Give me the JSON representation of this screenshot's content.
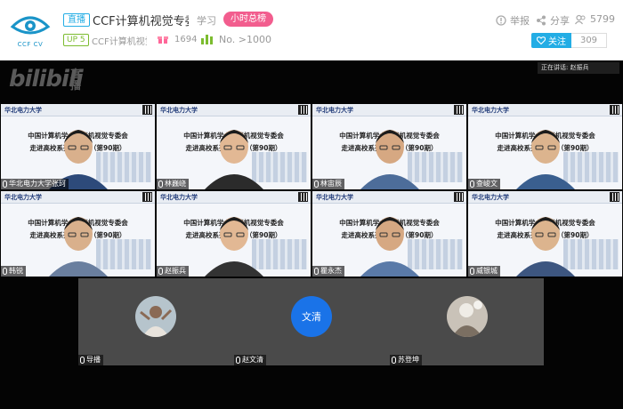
{
  "header": {
    "logo_text": "CCF CV",
    "live_badge": "直播",
    "room_title": "CCF计算机视觉专委会",
    "area": "学习",
    "rank_button": "小时总榜",
    "up_badge": "UP 5",
    "up_name": "CCF计算机视觉",
    "gift_count": "1694",
    "rank_text": "No. >1000",
    "report": "举报",
    "share": "分享",
    "viewers": "5799",
    "follow": "关注",
    "followers": "309",
    "accent": "#23ade5"
  },
  "player": {
    "brand": "bilibili",
    "brand_live": "直播",
    "speaker_label": "正在讲话: 赵振兵",
    "slide": {
      "university": "华北电力大学",
      "line1": "中国计算机学会计算机视觉专委会",
      "line2": "走进高校系列报告会（第90期）"
    },
    "tiles": [
      {
        "name": "华北电力大学张珂"
      },
      {
        "name": "林巍峣"
      },
      {
        "name": "林宙辰"
      },
      {
        "name": "查峻文"
      },
      {
        "name": "韩锐"
      },
      {
        "name": "赵振兵"
      },
      {
        "name": "瞿永杰"
      },
      {
        "name": "威银城"
      }
    ],
    "bottom": [
      {
        "name": "导播"
      },
      {
        "name": "赵文清",
        "avatar_text": "文清"
      },
      {
        "name": "苏登坤"
      }
    ]
  }
}
